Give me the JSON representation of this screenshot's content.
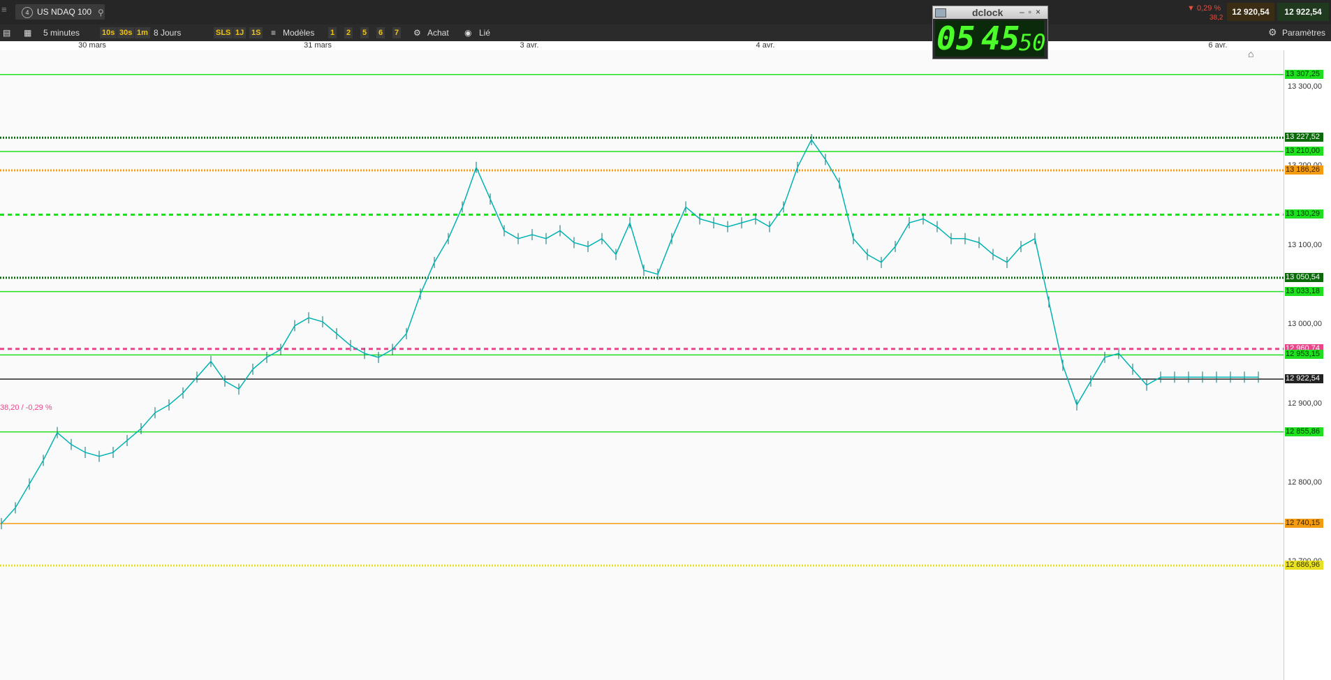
{
  "header": {
    "symbol_index": "4",
    "symbol_name": "US NDAQ 100",
    "change_pct": "▼ 0,29 %",
    "change_abs": "38,2",
    "bid": "12 920,54",
    "ask": "12 922,54"
  },
  "toolbar": {
    "timeframe": "5 minutes",
    "btn_10s": "10s",
    "btn_30s": "30s",
    "btn_1m": "1m",
    "range": "8 Jours",
    "btn_sls": "SLS",
    "btn_1j": "1J",
    "btn_1s": "1S",
    "models": "Modèles",
    "n1": "1",
    "n2": "2",
    "n3": "5",
    "n4": "6",
    "n5": "7",
    "achat": "Achat",
    "lie": "Lié",
    "parametres": "Paramètres"
  },
  "dclock": {
    "title": "dclock",
    "hours": "05",
    "minutes": "45",
    "seconds": "50"
  },
  "date_axis": [
    "30 mars",
    "31 mars",
    "3 avr.",
    "4 avr.",
    "6 avr."
  ],
  "price_axis": [
    "13 300,00",
    "13 200,00",
    "13 100,00",
    "13 000,00",
    "12 900,00",
    "12 800,00",
    "12 700,00"
  ],
  "levels": [
    {
      "label": "13 307,25",
      "price": 13307.25,
      "color": "#1ee01e",
      "style": "solid",
      "text_color": "#003300"
    },
    {
      "label": "13 227,52",
      "price": 13227.52,
      "color": "#0a6a0a",
      "style": "dotted",
      "text_color": "#ffffff"
    },
    {
      "label": "13 210,00",
      "price": 13210.0,
      "color": "#1ee01e",
      "style": "solid",
      "text_color": "#003300"
    },
    {
      "label": "13 186,26",
      "price": 13186.26,
      "color": "#f39c12",
      "style": "dotted",
      "text_color": "#402000"
    },
    {
      "label": "13 130,29",
      "price": 13130.29,
      "color": "#1ee01e",
      "style": "dashed",
      "text_color": "#003300"
    },
    {
      "label": "13 050,54",
      "price": 13050.54,
      "color": "#0a6a0a",
      "style": "dotted",
      "text_color": "#ffffff"
    },
    {
      "label": "13 033,18",
      "price": 13033.18,
      "color": "#1ee01e",
      "style": "solid",
      "text_color": "#003300"
    },
    {
      "label": "12 960,74",
      "price": 12960.74,
      "color": "#e8458b",
      "style": "dashed",
      "text_color": "#ffffff"
    },
    {
      "label": "12 953,15",
      "price": 12953.15,
      "color": "#1ee01e",
      "style": "solid",
      "text_color": "#003300"
    },
    {
      "label": "12 922,54",
      "price": 12922.54,
      "color": "#222222",
      "style": "solid",
      "text_color": "#ffffff"
    },
    {
      "label": "12 855,86",
      "price": 12855.86,
      "color": "#1ee01e",
      "style": "solid",
      "text_color": "#003300"
    },
    {
      "label": "12 740,15",
      "price": 12740.15,
      "color": "#f39c12",
      "style": "solid",
      "text_color": "#402000"
    },
    {
      "label": "12 686,96",
      "price": 12686.96,
      "color": "#e8e020",
      "style": "dotted",
      "text_color": "#333300"
    }
  ],
  "pink_label": "38,20 / -0,29 %",
  "chart_data": {
    "type": "line",
    "title": "",
    "series": [
      {
        "color": "#00b3b3",
        "x": [
          0,
          20,
          40,
          60,
          80,
          100,
          120,
          140,
          160,
          180,
          200,
          220,
          240,
          260,
          280,
          300,
          320,
          340,
          360,
          380,
          400,
          420,
          440,
          460,
          480,
          500,
          520,
          540,
          560,
          580,
          600,
          620,
          640,
          660,
          680,
          700,
          720,
          740,
          760,
          780,
          800,
          820,
          840,
          860,
          880,
          900,
          920,
          940,
          960,
          980,
          1000,
          1020,
          1040,
          1060,
          1080,
          1100,
          1120,
          1140,
          1160,
          1180,
          1200,
          1220,
          1240,
          1260,
          1280,
          1300,
          1320,
          1340,
          1360,
          1380,
          1400,
          1420,
          1440,
          1460,
          1480,
          1500,
          1520,
          1540,
          1560,
          1580,
          1600,
          1620,
          1640,
          1660,
          1680,
          1700,
          1720,
          1740,
          1760,
          1780,
          1800
        ],
        "values": [
          12740,
          12760,
          12790,
          12820,
          12855,
          12840,
          12830,
          12825,
          12830,
          12845,
          12860,
          12880,
          12890,
          12905,
          12925,
          12945,
          12920,
          12910,
          12935,
          12950,
          12960,
          12990,
          13000,
          12995,
          12980,
          12965,
          12955,
          12950,
          12960,
          12980,
          13030,
          13070,
          13100,
          13140,
          13190,
          13150,
          13110,
          13100,
          13105,
          13100,
          13110,
          13095,
          13090,
          13100,
          13080,
          13120,
          13060,
          13055,
          13100,
          13140,
          13125,
          13120,
          13115,
          13120,
          13125,
          13115,
          13140,
          13190,
          13225,
          13200,
          13170,
          13100,
          13080,
          13070,
          13090,
          13120,
          13125,
          13115,
          13100,
          13100,
          13095,
          13080,
          13070,
          13090,
          13100,
          13020,
          12940,
          12890,
          12920,
          12950,
          12955,
          12935,
          12915,
          12925,
          12925,
          12925,
          12925,
          12925,
          12925,
          12925,
          12925
        ]
      }
    ],
    "ylim": [
      12670,
      13330
    ]
  }
}
